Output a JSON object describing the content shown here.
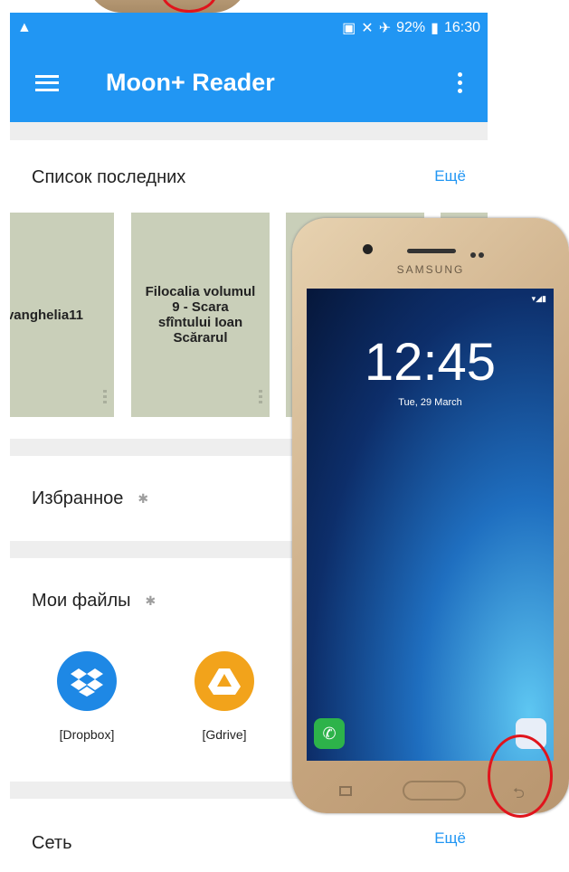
{
  "status_bar": {
    "battery": "92%",
    "time": "16:30"
  },
  "toolbar": {
    "title": "Moon+ Reader"
  },
  "recent": {
    "title": "Список последних",
    "more": "Ещё",
    "books": [
      {
        "title": "vanghelia11"
      },
      {
        "title": "Filocalia volumul 9 - Scara sfîntului Ioan Scărarul"
      }
    ]
  },
  "favorites": {
    "title": "Избранное"
  },
  "myfiles": {
    "title": "Мои файлы",
    "items": [
      {
        "label": "[Dropbox]",
        "icon": "dropbox-icon",
        "color": "#1e88e5"
      },
      {
        "label": "[Gdrive]",
        "icon": "gdrive-icon",
        "color": "#f2a31b"
      }
    ]
  },
  "network": {
    "title": "Сеть",
    "more": "Ещё"
  },
  "overlay_phone": {
    "brand": "SAMSUNG",
    "clock": "12:45",
    "date": "Tue, 29 March"
  },
  "colors": {
    "primary": "#2196f3",
    "annotation": "#e0141c"
  }
}
